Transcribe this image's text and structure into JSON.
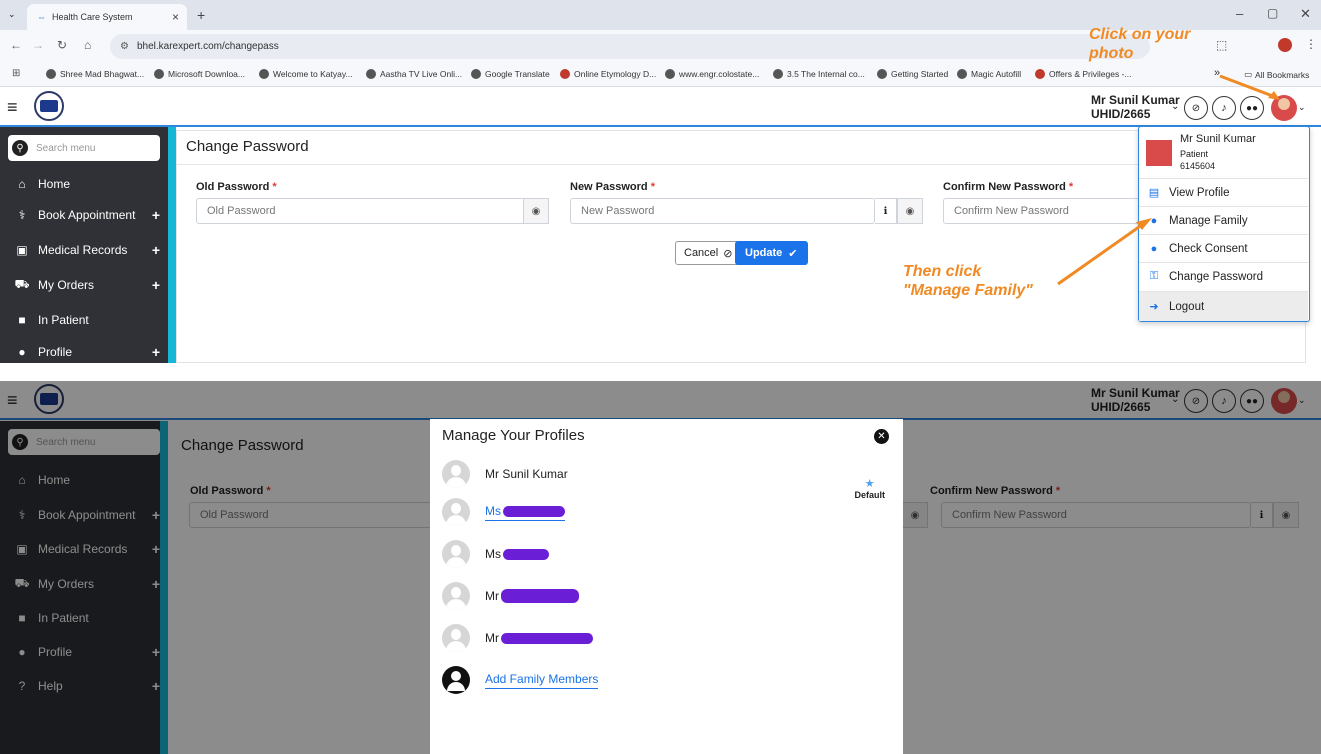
{
  "browser": {
    "tab_title": "Health Care System",
    "tab_close": "×",
    "new_tab": "+",
    "url": "bhel.karexpert.com/changepass",
    "bookmarks": [
      "Shree Mad Bhagwat...",
      "Microsoft Downloa...",
      "Welcome to Katyay...",
      "Aastha TV Live Onli...",
      "Google Translate",
      "Online Etymology D...",
      "www.engr.colostate...",
      "3.5 The Internal co...",
      "Getting Started",
      "Magic Autofill",
      "Offers & Privileges -..."
    ],
    "more_bookmarks": "»",
    "all_bookmarks": "All Bookmarks"
  },
  "header": {
    "user_name": "Mr Sunil Kumar",
    "uhid": "UHID/2665"
  },
  "search": {
    "placeholder": "Search menu"
  },
  "sidebar": {
    "items": [
      {
        "label": "Home",
        "plus": ""
      },
      {
        "label": "Book Appointment",
        "plus": "+"
      },
      {
        "label": "Medical Records",
        "plus": "+"
      },
      {
        "label": "My Orders",
        "plus": "+"
      },
      {
        "label": "In Patient",
        "plus": ""
      },
      {
        "label": "Profile",
        "plus": "+"
      },
      {
        "label": "Help",
        "plus": "+"
      }
    ]
  },
  "form": {
    "title": "Change Password",
    "old_label": "Old Password",
    "new_label": "New Password",
    "confirm_label": "Confirm New Password",
    "required_mark": "*",
    "old_placeholder": "Old Password",
    "new_placeholder": "New Password",
    "confirm_placeholder": "Confirm New Password",
    "cancel": "Cancel",
    "update": "Update"
  },
  "profile_menu": {
    "name": "Mr Sunil Kumar",
    "role": "Patient",
    "id": "6145604",
    "items": [
      "View Profile",
      "Manage Family",
      "Check Consent",
      "Change Password",
      "Logout"
    ]
  },
  "annotations": {
    "click_photo_1": "Click on your",
    "click_photo_2": "photo",
    "then_click_1": "Then click",
    "then_click_2": "\"Manage Family\""
  },
  "modal": {
    "title": "Manage Your Profiles",
    "default_label": "Default",
    "profiles": [
      {
        "prefix": "Mr Sunil Kumar"
      },
      {
        "prefix": "Ms"
      },
      {
        "prefix": "Ms"
      },
      {
        "prefix": "Mr"
      },
      {
        "prefix": "Mr"
      }
    ],
    "add_label": "Add Family Members"
  },
  "colors": {
    "accent": "#1a73e8",
    "sidebar_bg": "#2f3136",
    "sidebar_accent": "#16b6d6",
    "annotation": "#f08a24",
    "redaction": "#6a1fd6"
  }
}
